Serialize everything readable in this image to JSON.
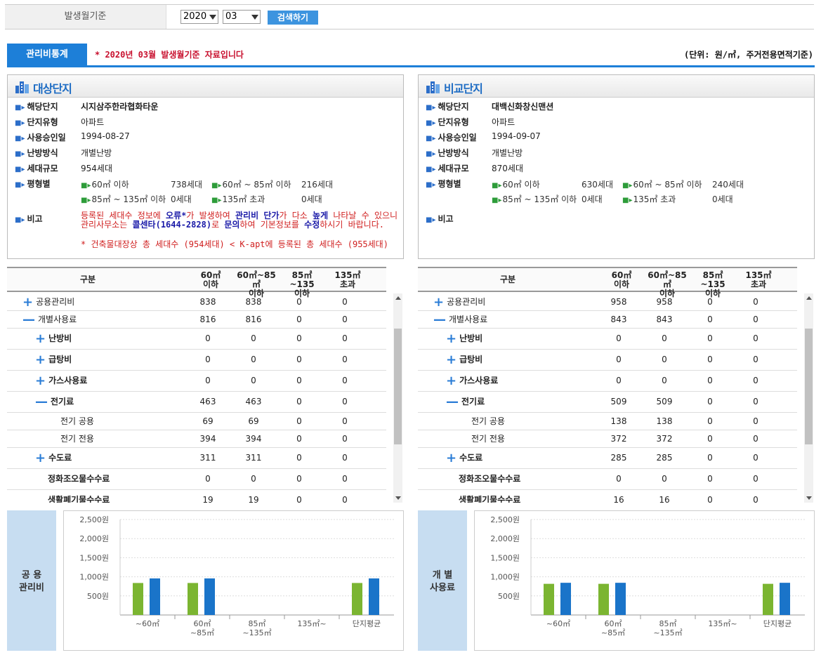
{
  "search": {
    "label": "발생월기준",
    "year": "2020",
    "month": "03",
    "button": "검색하기"
  },
  "stats_tab": "관리비통계",
  "notice": "* 2020년 03월 발생월기준 자료입니다",
  "unit": "(단위: 원/㎡, 주거전용면적기준)",
  "target": {
    "title": "대상단지",
    "labels": {
      "name": "해당단지",
      "type": "단지유형",
      "approval": "사용승인일",
      "heating": "난방방식",
      "households": "세대규모",
      "pyeong": "평형별",
      "remark": "비고"
    },
    "name": "시지삼주한라협화타운",
    "type": "아파트",
    "approval": "1994-08-27",
    "heating": "개별난방",
    "households": "954세대",
    "pyeong": [
      {
        "label": "60㎡ 이하",
        "value": "738세대"
      },
      {
        "label": "60㎡ ~ 85㎡ 이하",
        "value": "216세대"
      },
      {
        "label": "85㎡ ~ 135㎡ 이하",
        "value": "0세대"
      },
      {
        "label": "135㎡ 초과",
        "value": "0세대"
      }
    ],
    "remark": {
      "p1": "등록된 세대수 정보에 ",
      "b1": "오류*",
      "p2": "가 발생하여 ",
      "b2": "관리비 단가",
      "p3": "가 다소 ",
      "b3": "높게",
      "p4": " 나타날 수 있으니 관리사무소는 ",
      "b4": "콜센타(1644-2828)",
      "p5": "로 ",
      "b5": "문의",
      "p6": "하여 기본정보를 ",
      "b6": "수정",
      "p7": "하시기 바랍니다.",
      "line2": "* 건축물대장상 총 세대수 (954세대) < K-apt에 등록된 총 세대수 (955세대)"
    }
  },
  "compare": {
    "title": "비교단지",
    "labels": {
      "name": "해당단지",
      "type": "단지유형",
      "approval": "사용승인일",
      "heating": "난방방식",
      "households": "세대규모",
      "pyeong": "평형별",
      "remark": "비고"
    },
    "name": "대백신화창신맨션",
    "type": "아파트",
    "approval": "1994-09-07",
    "heating": "개별난방",
    "households": "870세대",
    "pyeong": [
      {
        "label": "60㎡ 이하",
        "value": "630세대"
      },
      {
        "label": "60㎡ ~ 85㎡ 이하",
        "value": "240세대"
      },
      {
        "label": "85㎡ ~ 135㎡ 이하",
        "value": "0세대"
      },
      {
        "label": "135㎡ 초과",
        "value": "0세대"
      }
    ]
  },
  "table_headers": {
    "category": "구분",
    "c1a": "60㎡",
    "c1b": "이하",
    "c2a": "60㎡~85㎡",
    "c2b": "이하",
    "c3a": "85㎡~135",
    "c3b": "이하",
    "c4a": "135㎡",
    "c4b": "초과"
  },
  "target_rows": [
    {
      "label": "공용관리비",
      "sign": "+",
      "vals": [
        "838",
        "838",
        "0",
        "0"
      ]
    },
    {
      "label": "개별사용료",
      "sign": "−",
      "vals": [
        "816",
        "816",
        "0",
        "0"
      ]
    },
    {
      "label": "난방비",
      "sign": "+",
      "vals": [
        "0",
        "0",
        "0",
        "0"
      ]
    },
    {
      "label": "급탕비",
      "sign": "+",
      "vals": [
        "0",
        "0",
        "0",
        "0"
      ]
    },
    {
      "label": "가스사용료",
      "sign": "+",
      "vals": [
        "0",
        "0",
        "0",
        "0"
      ]
    },
    {
      "label": "전기료",
      "sign": "−",
      "vals": [
        "463",
        "463",
        "0",
        "0"
      ]
    },
    {
      "label": "전기 공용",
      "sign": "",
      "vals": [
        "69",
        "69",
        "0",
        "0"
      ]
    },
    {
      "label": "전기 전용",
      "sign": "",
      "vals": [
        "394",
        "394",
        "0",
        "0"
      ]
    },
    {
      "label": "수도료",
      "sign": "+",
      "vals": [
        "311",
        "311",
        "0",
        "0"
      ]
    },
    {
      "label": "정화조오물수수료",
      "sign": "",
      "vals": [
        "0",
        "0",
        "0",
        "0"
      ]
    },
    {
      "label": "생활폐기물수수료",
      "sign": "",
      "vals": [
        "19",
        "19",
        "0",
        "0"
      ]
    }
  ],
  "compare_rows": [
    {
      "label": "공용관리비",
      "sign": "+",
      "vals": [
        "958",
        "958",
        "0",
        "0"
      ]
    },
    {
      "label": "개별사용료",
      "sign": "−",
      "vals": [
        "843",
        "843",
        "0",
        "0"
      ]
    },
    {
      "label": "난방비",
      "sign": "+",
      "vals": [
        "0",
        "0",
        "0",
        "0"
      ]
    },
    {
      "label": "급탕비",
      "sign": "+",
      "vals": [
        "0",
        "0",
        "0",
        "0"
      ]
    },
    {
      "label": "가스사용료",
      "sign": "+",
      "vals": [
        "0",
        "0",
        "0",
        "0"
      ]
    },
    {
      "label": "전기료",
      "sign": "−",
      "vals": [
        "509",
        "509",
        "0",
        "0"
      ]
    },
    {
      "label": "전기 공용",
      "sign": "",
      "vals": [
        "138",
        "138",
        "0",
        "0"
      ]
    },
    {
      "label": "전기 전용",
      "sign": "",
      "vals": [
        "372",
        "372",
        "0",
        "0"
      ]
    },
    {
      "label": "수도료",
      "sign": "+",
      "vals": [
        "285",
        "285",
        "0",
        "0"
      ]
    },
    {
      "label": "정화조오물수수료",
      "sign": "",
      "vals": [
        "0",
        "0",
        "0",
        "0"
      ]
    },
    {
      "label": "생활폐기물수수료",
      "sign": "",
      "vals": [
        "16",
        "16",
        "0",
        "0"
      ]
    }
  ],
  "chart_data": [
    {
      "type": "bar",
      "side_label": [
        "공 용",
        "관리비"
      ],
      "categories": [
        "~60㎡",
        "60㎡ ~85㎡",
        "85㎡ ~135㎡",
        "135㎡~",
        "단지평균"
      ],
      "series": [
        {
          "color": "#7bb531",
          "values": [
            838,
            838,
            0,
            0,
            838
          ]
        },
        {
          "color": "#1a74c9",
          "values": [
            958,
            958,
            0,
            0,
            958
          ]
        }
      ],
      "yticks": [
        "500원",
        "1,000원",
        "1,500원",
        "2,000원",
        "2,500원"
      ],
      "ylim": [
        0,
        2500
      ]
    },
    {
      "type": "bar",
      "side_label": [
        "개 별",
        "사용료"
      ],
      "categories": [
        "~60㎡",
        "60㎡ ~85㎡",
        "85㎡ ~135㎡",
        "135㎡~",
        "단지평균"
      ],
      "series": [
        {
          "color": "#7bb531",
          "values": [
            816,
            816,
            0,
            0,
            816
          ]
        },
        {
          "color": "#1a74c9",
          "values": [
            843,
            843,
            0,
            0,
            843
          ]
        }
      ],
      "yticks": [
        "500원",
        "1,000원",
        "1,500원",
        "2,000원",
        "2,500원"
      ],
      "ylim": [
        0,
        2500
      ]
    }
  ]
}
